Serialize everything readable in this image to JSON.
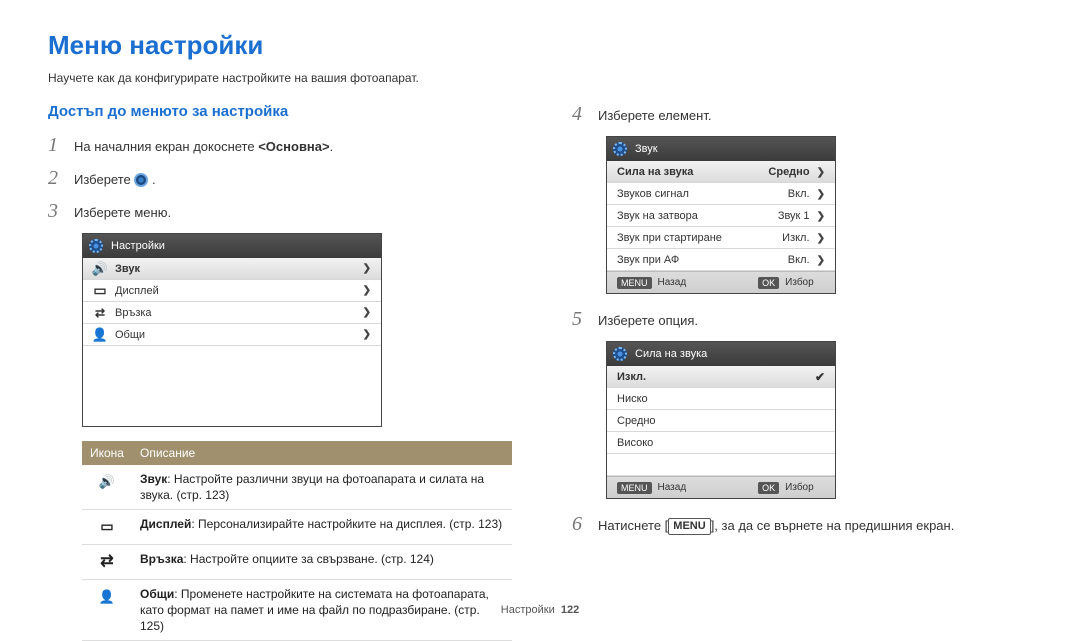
{
  "title": "Меню настройки",
  "intro": "Научете как да конфигурирате настройките на вашия фотоапарат.",
  "section_heading": "Достъп до менюто за настройка",
  "steps_left": {
    "s1_pre": "На началния екран докоснете ",
    "s1_bold": "<Основна>",
    "s1_post": ".",
    "s2_pre": "Изберете ",
    "s2_post": ".",
    "s3": "Изберете меню."
  },
  "menu_panel": {
    "title": "Настройки",
    "items": [
      {
        "label": "Звук",
        "icon": "speaker"
      },
      {
        "label": "Дисплей",
        "icon": "display"
      },
      {
        "label": "Връзка",
        "icon": "connect"
      },
      {
        "label": "Общи",
        "icon": "person"
      }
    ]
  },
  "desc_table": {
    "head_icon": "Икона",
    "head_desc": "Описание",
    "rows": [
      {
        "icon": "speaker",
        "bold": "Звук",
        "text": ": Настройте различни звуци на фотоапарата и силата на звука. (стр. 123)"
      },
      {
        "icon": "display",
        "bold": "Дисплей",
        "text": ": Персонализирайте настройките на дисплея. (стр. 123)"
      },
      {
        "icon": "connect",
        "bold": "Връзка",
        "text": ": Настройте опциите за свързване. (стр. 124)"
      },
      {
        "icon": "person",
        "bold": "Общи",
        "text": ": Променете настройките на системата на фотоапарата, като формат на памет и име на файл по подразбиране. (стр. 125)"
      }
    ]
  },
  "steps_right": {
    "s4": "Изберете елемент.",
    "s5": "Изберете опция.",
    "s6_pre": "Натиснете [",
    "s6_btn": "MENU",
    "s6_post": "], за да се върнете на предишния екран."
  },
  "sound_panel": {
    "title": "Звук",
    "rows": [
      {
        "label": "Сила на звука",
        "value": "Средно",
        "selected": true
      },
      {
        "label": "Звуков сигнал",
        "value": "Вкл."
      },
      {
        "label": "Звук на затвора",
        "value": "Звук 1"
      },
      {
        "label": "Звук при стартиране",
        "value": "Изкл."
      },
      {
        "label": "Звук при АФ",
        "value": "Вкл."
      }
    ],
    "footer": {
      "menu": "MENU",
      "back": "Назад",
      "ok": "OK",
      "select": "Избор"
    }
  },
  "volume_panel": {
    "title": "Сила на звука",
    "options": [
      {
        "label": "Изкл.",
        "selected": true
      },
      {
        "label": "Ниско"
      },
      {
        "label": "Средно"
      },
      {
        "label": "Високо"
      }
    ],
    "footer": {
      "menu": "MENU",
      "back": "Назад",
      "ok": "OK",
      "select": "Избор"
    }
  },
  "page_footer": {
    "section": "Настройки",
    "page": "122"
  }
}
